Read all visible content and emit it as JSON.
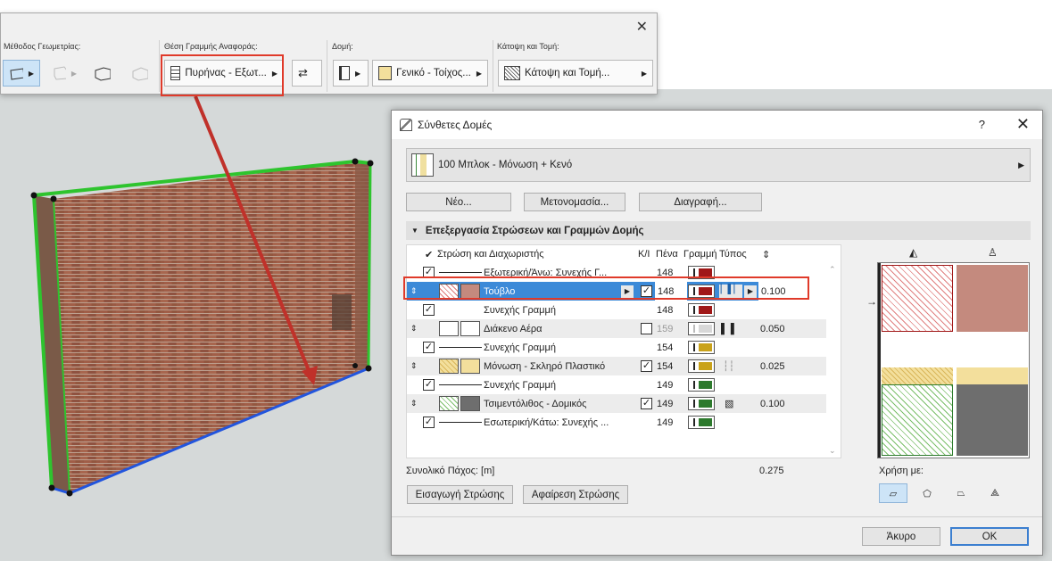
{
  "toolbar": {
    "groups": [
      {
        "label": "Μέθοδος Γεωμετρίας:"
      },
      {
        "label": "Θέση Γραμμής Αναφοράς:"
      },
      {
        "label": "Δομή:"
      },
      {
        "label": "Κάτοψη και Τομή:"
      }
    ],
    "reference_line_value": "Πυρήνας - Εξωτ...",
    "structure_value": "Γενικό - Τοίχος...",
    "floorplan_value": "Κάτοψη και Τομή...",
    "close_glyph": "✕"
  },
  "dialog": {
    "title": "Σύνθετες Δομές",
    "help": "?",
    "close": "✕",
    "composite_name": "100 Μπλοκ - Μόνωση + Κενό",
    "buttons": {
      "new": "Νέο...",
      "rename": "Μετονομασία...",
      "delete": "Διαγραφή..."
    },
    "section_title": "Επεξεργασία Στρώσεων και Γραμμών Δομής",
    "columns": {
      "layer": "Στρώση και Διαχωριστής",
      "kl": "K/I",
      "pen": "Πένα",
      "line": "Γραμμή",
      "type": "Τύπος"
    },
    "rows": [
      {
        "kind": "line",
        "name": "Εξωτερική/Άνω: Συνεχής Γ...",
        "pen": "148",
        "pen_color": "#a01818",
        "checked": true
      },
      {
        "kind": "layer",
        "name": "Τούβλο",
        "pen": "148",
        "pen_color": "#a01818",
        "thickness": "0.100",
        "fill": "#c48a7e",
        "hatch": "#d77",
        "selected": true,
        "checked": true
      },
      {
        "kind": "line",
        "name": "Συνεχής Γραμμή",
        "pen": "148",
        "pen_color": "#a01818",
        "checked": true
      },
      {
        "kind": "layer",
        "name": "Διάκενο Αέρα",
        "pen": "159",
        "pen_color": "#d8d8d8",
        "thickness": "0.050",
        "fill": "#ffffff",
        "hatch": "#fff",
        "checked": false
      },
      {
        "kind": "line",
        "name": "Συνεχής Γραμμή",
        "pen": "154",
        "pen_color": "#c9a21a",
        "checked": true
      },
      {
        "kind": "layer",
        "name": "Μόνωση - Σκληρό Πλαστικό",
        "pen": "154",
        "pen_color": "#c9a21a",
        "thickness": "0.025",
        "fill": "#f3df9c",
        "hatch": "#e5c46a",
        "checked": true
      },
      {
        "kind": "line",
        "name": "Συνεχής Γραμμή",
        "pen": "149",
        "pen_color": "#2d7a2d",
        "checked": true
      },
      {
        "kind": "layer",
        "name": "Τσιμεντόλιθος - Δομικός",
        "pen": "149",
        "pen_color": "#2d7a2d",
        "thickness": "0.100",
        "fill": "#6e6e6e",
        "hatch": "#7bbf6a",
        "checked": true
      },
      {
        "kind": "line",
        "name": "Εσωτερική/Κάτω: Συνεχής ...",
        "pen": "149",
        "pen_color": "#2d7a2d",
        "checked": true
      }
    ],
    "total_label": "Συνολικό Πάχος: [m]",
    "total_value": "0.275",
    "use_label": "Χρήση με:",
    "insert_layer": "Εισαγωγή Στρώσης",
    "remove_layer": "Αφαίρεση Στρώσης",
    "cancel": "Άκυρο",
    "ok": "OK"
  }
}
